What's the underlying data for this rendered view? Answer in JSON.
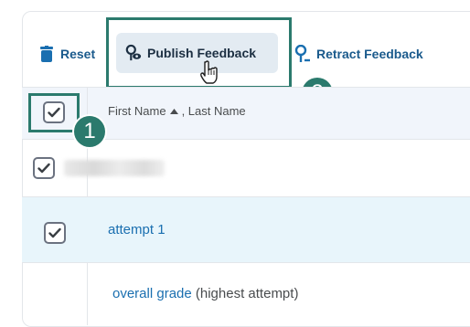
{
  "toolbar": {
    "reset_label": "Reset",
    "publish_label": "Publish Feedback",
    "retract_label": "Retract Feedback"
  },
  "badges": {
    "one": "1",
    "two": "2"
  },
  "grid": {
    "header_label": "First Name",
    "header_sort_icon": "caret-up-icon",
    "header_label_suffix": ", Last Name",
    "rows": [
      {
        "name_redacted": true,
        "checked": true
      },
      {
        "link": "attempt 1",
        "checked": true
      },
      {
        "link": "overall grade",
        "note": "(highest attempt)"
      }
    ]
  },
  "colors": {
    "accent": "#2b7a6d",
    "link": "#1a6fb0",
    "selected_row": "#e8f5fb"
  }
}
